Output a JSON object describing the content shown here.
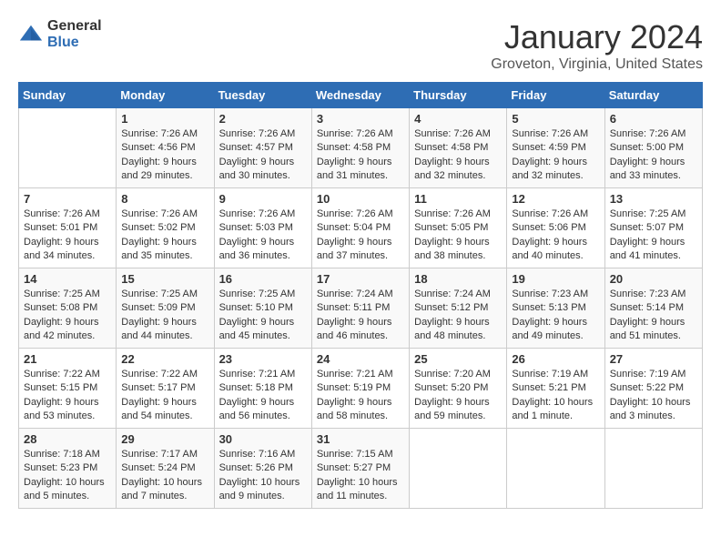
{
  "header": {
    "logo_general": "General",
    "logo_blue": "Blue",
    "month_title": "January 2024",
    "location": "Groveton, Virginia, United States"
  },
  "days_of_week": [
    "Sunday",
    "Monday",
    "Tuesday",
    "Wednesday",
    "Thursday",
    "Friday",
    "Saturday"
  ],
  "weeks": [
    [
      {
        "day": "",
        "info": ""
      },
      {
        "day": "1",
        "info": "Sunrise: 7:26 AM\nSunset: 4:56 PM\nDaylight: 9 hours\nand 29 minutes."
      },
      {
        "day": "2",
        "info": "Sunrise: 7:26 AM\nSunset: 4:57 PM\nDaylight: 9 hours\nand 30 minutes."
      },
      {
        "day": "3",
        "info": "Sunrise: 7:26 AM\nSunset: 4:58 PM\nDaylight: 9 hours\nand 31 minutes."
      },
      {
        "day": "4",
        "info": "Sunrise: 7:26 AM\nSunset: 4:58 PM\nDaylight: 9 hours\nand 32 minutes."
      },
      {
        "day": "5",
        "info": "Sunrise: 7:26 AM\nSunset: 4:59 PM\nDaylight: 9 hours\nand 32 minutes."
      },
      {
        "day": "6",
        "info": "Sunrise: 7:26 AM\nSunset: 5:00 PM\nDaylight: 9 hours\nand 33 minutes."
      }
    ],
    [
      {
        "day": "7",
        "info": "Sunrise: 7:26 AM\nSunset: 5:01 PM\nDaylight: 9 hours\nand 34 minutes."
      },
      {
        "day": "8",
        "info": "Sunrise: 7:26 AM\nSunset: 5:02 PM\nDaylight: 9 hours\nand 35 minutes."
      },
      {
        "day": "9",
        "info": "Sunrise: 7:26 AM\nSunset: 5:03 PM\nDaylight: 9 hours\nand 36 minutes."
      },
      {
        "day": "10",
        "info": "Sunrise: 7:26 AM\nSunset: 5:04 PM\nDaylight: 9 hours\nand 37 minutes."
      },
      {
        "day": "11",
        "info": "Sunrise: 7:26 AM\nSunset: 5:05 PM\nDaylight: 9 hours\nand 38 minutes."
      },
      {
        "day": "12",
        "info": "Sunrise: 7:26 AM\nSunset: 5:06 PM\nDaylight: 9 hours\nand 40 minutes."
      },
      {
        "day": "13",
        "info": "Sunrise: 7:25 AM\nSunset: 5:07 PM\nDaylight: 9 hours\nand 41 minutes."
      }
    ],
    [
      {
        "day": "14",
        "info": "Sunrise: 7:25 AM\nSunset: 5:08 PM\nDaylight: 9 hours\nand 42 minutes."
      },
      {
        "day": "15",
        "info": "Sunrise: 7:25 AM\nSunset: 5:09 PM\nDaylight: 9 hours\nand 44 minutes."
      },
      {
        "day": "16",
        "info": "Sunrise: 7:25 AM\nSunset: 5:10 PM\nDaylight: 9 hours\nand 45 minutes."
      },
      {
        "day": "17",
        "info": "Sunrise: 7:24 AM\nSunset: 5:11 PM\nDaylight: 9 hours\nand 46 minutes."
      },
      {
        "day": "18",
        "info": "Sunrise: 7:24 AM\nSunset: 5:12 PM\nDaylight: 9 hours\nand 48 minutes."
      },
      {
        "day": "19",
        "info": "Sunrise: 7:23 AM\nSunset: 5:13 PM\nDaylight: 9 hours\nand 49 minutes."
      },
      {
        "day": "20",
        "info": "Sunrise: 7:23 AM\nSunset: 5:14 PM\nDaylight: 9 hours\nand 51 minutes."
      }
    ],
    [
      {
        "day": "21",
        "info": "Sunrise: 7:22 AM\nSunset: 5:15 PM\nDaylight: 9 hours\nand 53 minutes."
      },
      {
        "day": "22",
        "info": "Sunrise: 7:22 AM\nSunset: 5:17 PM\nDaylight: 9 hours\nand 54 minutes."
      },
      {
        "day": "23",
        "info": "Sunrise: 7:21 AM\nSunset: 5:18 PM\nDaylight: 9 hours\nand 56 minutes."
      },
      {
        "day": "24",
        "info": "Sunrise: 7:21 AM\nSunset: 5:19 PM\nDaylight: 9 hours\nand 58 minutes."
      },
      {
        "day": "25",
        "info": "Sunrise: 7:20 AM\nSunset: 5:20 PM\nDaylight: 9 hours\nand 59 minutes."
      },
      {
        "day": "26",
        "info": "Sunrise: 7:19 AM\nSunset: 5:21 PM\nDaylight: 10 hours\nand 1 minute."
      },
      {
        "day": "27",
        "info": "Sunrise: 7:19 AM\nSunset: 5:22 PM\nDaylight: 10 hours\nand 3 minutes."
      }
    ],
    [
      {
        "day": "28",
        "info": "Sunrise: 7:18 AM\nSunset: 5:23 PM\nDaylight: 10 hours\nand 5 minutes."
      },
      {
        "day": "29",
        "info": "Sunrise: 7:17 AM\nSunset: 5:24 PM\nDaylight: 10 hours\nand 7 minutes."
      },
      {
        "day": "30",
        "info": "Sunrise: 7:16 AM\nSunset: 5:26 PM\nDaylight: 10 hours\nand 9 minutes."
      },
      {
        "day": "31",
        "info": "Sunrise: 7:15 AM\nSunset: 5:27 PM\nDaylight: 10 hours\nand 11 minutes."
      },
      {
        "day": "",
        "info": ""
      },
      {
        "day": "",
        "info": ""
      },
      {
        "day": "",
        "info": ""
      }
    ]
  ]
}
